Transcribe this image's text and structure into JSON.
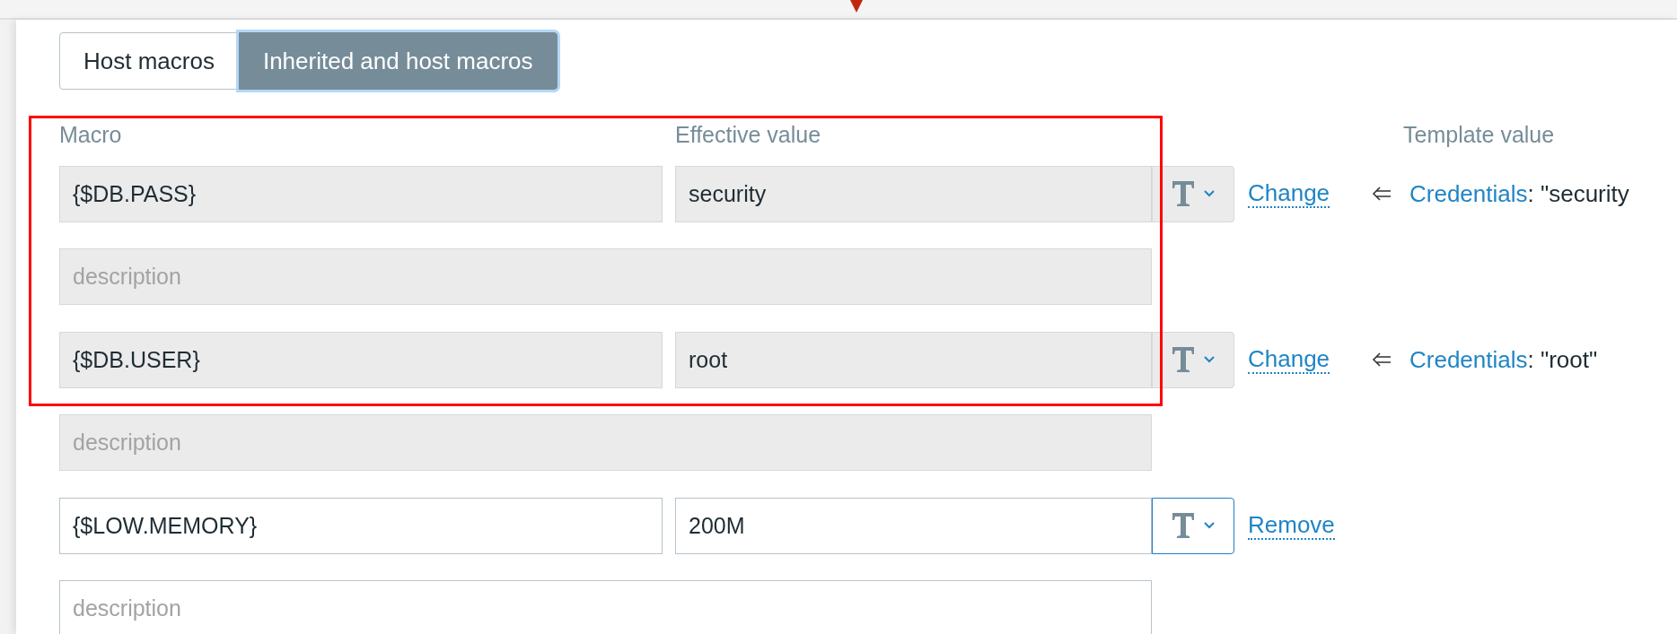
{
  "tabs": [
    {
      "label": "Host macros",
      "selected": false
    },
    {
      "label": "Inherited and host macros",
      "selected": true
    }
  ],
  "columns": {
    "macro": "Macro",
    "effective_value": "Effective value",
    "template_value": "Template value"
  },
  "macros": [
    {
      "macro": "{$DB.PASS}",
      "value": "security",
      "description_placeholder": "description",
      "disabled": true,
      "action": "Change",
      "template": {
        "name": "Credentials",
        "value": ": \"security"
      }
    },
    {
      "macro": "{$DB.USER}",
      "value": "root",
      "description_placeholder": "description",
      "disabled": true,
      "action": "Change",
      "template": {
        "name": "Credentials",
        "value": ": \"root\""
      }
    },
    {
      "macro": "{$LOW.MEMORY}",
      "value": "200M",
      "description_placeholder": "description",
      "disabled": false,
      "action": "Remove"
    }
  ]
}
